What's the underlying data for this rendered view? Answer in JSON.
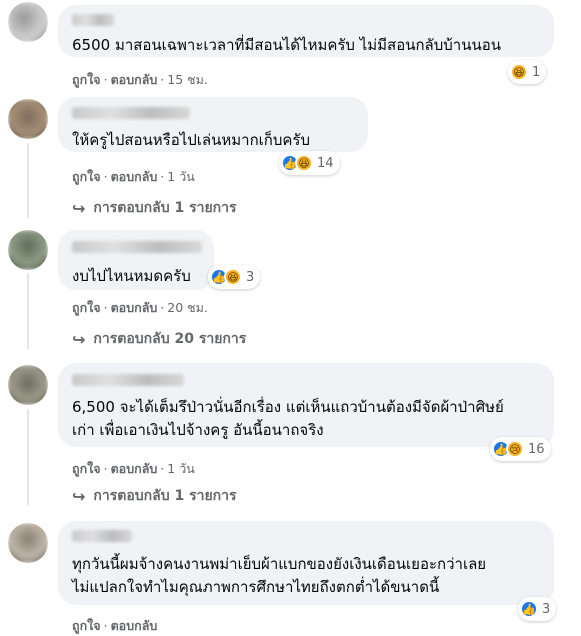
{
  "comments": [
    {
      "text_lines": [
        "6500 มาสอนเฉพาะเวลาที่มีสอนได้ไหมครับ ไม่มีสอนกลับบ้านนอน"
      ],
      "like": "ถูกใจ",
      "reply": "ตอบกลับ",
      "sep": "·",
      "time": "15 ชม.",
      "reaction_count": "1",
      "reaction_icons": [
        "haha-icon"
      ],
      "replies_label": ""
    },
    {
      "text_lines": [
        "ให้ครูไปสอนหรือไปเล่นหมากเก็บครับ"
      ],
      "like": "ถูกใจ",
      "reply": "ตอบกลับ",
      "sep": "·",
      "time": "1 วัน",
      "reaction_count": "14",
      "reaction_icons": [
        "like-icon",
        "haha-icon"
      ],
      "replies_label": "การตอบกลับ 1 รายการ"
    },
    {
      "text_lines": [
        "งบไปไหนหมดครับ"
      ],
      "like": "ถูกใจ",
      "reply": "ตอบกลับ",
      "sep": "·",
      "time": "20 ชม.",
      "reaction_count": "3",
      "reaction_icons": [
        "like-icon",
        "haha-icon"
      ],
      "replies_label": "การตอบกลับ 20 รายการ"
    },
    {
      "text_lines": [
        "6,500 จะได้เต็มรึป่าวนั่นอีกเรื่อง แต่เห็นแถวบ้านต้องมีจัดผ้าป่าศิษย์",
        "เก่า เพื่อเอาเงินไปจ้างครู อันนี้อนาถจริง"
      ],
      "like": "ถูกใจ",
      "reply": "ตอบกลับ",
      "sep": "·",
      "time": "1 วัน",
      "reaction_count": "16",
      "reaction_icons": [
        "like-icon",
        "sad-icon"
      ],
      "replies_label": "การตอบกลับ 1 รายการ"
    },
    {
      "text_lines": [
        "ทุกวันนี้ผมจ้างคนงานพม่าเย็บผ้าแบกของยังเงินเดือนเยอะกว่าเลย",
        "ไม่แปลกใจทำไมคุณภาพการศึกษาไทยถึงตกต่ำได้ขนาดนี้"
      ],
      "like": "ถูกใจ",
      "reply": "ตอบกลับ",
      "sep": "·",
      "time": "",
      "reaction_count": "3",
      "reaction_icons": [
        "like-icon"
      ],
      "replies_label": ""
    }
  ]
}
